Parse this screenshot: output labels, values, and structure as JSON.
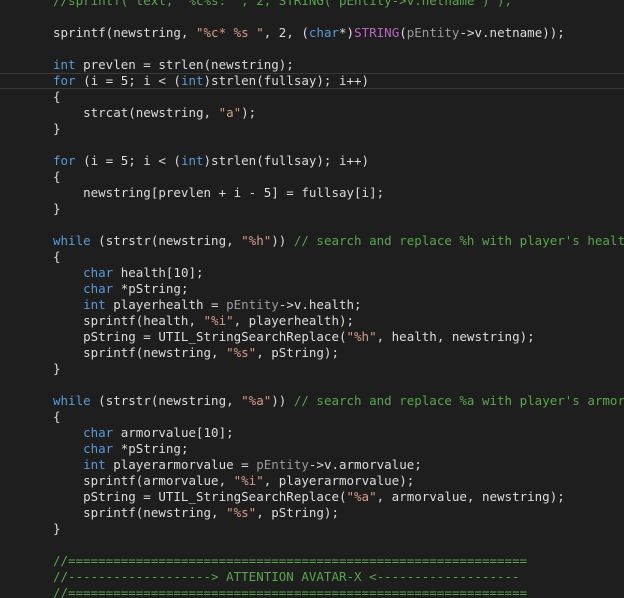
{
  "editor": {
    "colors": {
      "background": "#1e1e1e",
      "plain": "#dcdcdc",
      "keyword": "#569cd6",
      "string": "#d69d85",
      "comment": "#57a64a",
      "macro": "#bd63c5",
      "grey_member": "#9b9b9b"
    },
    "current_line_index": 5,
    "lines": [
      [
        {
          "t": "//sprintf( text, \"%c%s: \", 2, STRING( pEntity->v.netname ) );",
          "c": "c"
        }
      ],
      [],
      [
        {
          "t": "sprintf(newstring, ",
          "c": "p"
        },
        {
          "t": "\"%c* %s \"",
          "c": "s"
        },
        {
          "t": ", 2, (",
          "c": "p"
        },
        {
          "t": "char",
          "c": "k"
        },
        {
          "t": "*)",
          "c": "p"
        },
        {
          "t": "STRING",
          "c": "m"
        },
        {
          "t": "(",
          "c": "p"
        },
        {
          "t": "pEntity",
          "c": "g"
        },
        {
          "t": "->v.netname));",
          "c": "p"
        }
      ],
      [],
      [
        {
          "t": "int",
          "c": "k"
        },
        {
          "t": " prevlen = strlen(newstring);",
          "c": "p"
        }
      ],
      [
        {
          "t": "for",
          "c": "k"
        },
        {
          "t": " (i = 5; i < (",
          "c": "p"
        },
        {
          "t": "int",
          "c": "k"
        },
        {
          "t": ")strlen(fullsay); i++)",
          "c": "p"
        }
      ],
      [
        {
          "t": "{",
          "c": "p"
        }
      ],
      [
        {
          "t": "    strcat(newstring, ",
          "c": "p"
        },
        {
          "t": "\"a\"",
          "c": "s"
        },
        {
          "t": ");",
          "c": "p"
        }
      ],
      [
        {
          "t": "}",
          "c": "p"
        }
      ],
      [],
      [
        {
          "t": "for",
          "c": "k"
        },
        {
          "t": " (i = 5; i < (",
          "c": "p"
        },
        {
          "t": "int",
          "c": "k"
        },
        {
          "t": ")strlen(fullsay); i++)",
          "c": "p"
        }
      ],
      [
        {
          "t": "{",
          "c": "p"
        }
      ],
      [
        {
          "t": "    newstring[prevlen + i - 5] = fullsay[i];",
          "c": "p"
        }
      ],
      [
        {
          "t": "}",
          "c": "p"
        }
      ],
      [],
      [
        {
          "t": "while",
          "c": "k"
        },
        {
          "t": " (strstr(newstring, ",
          "c": "p"
        },
        {
          "t": "\"%h\"",
          "c": "s"
        },
        {
          "t": ")) ",
          "c": "p"
        },
        {
          "t": "// search and replace %h with player's health",
          "c": "c"
        }
      ],
      [
        {
          "t": "{",
          "c": "p"
        }
      ],
      [
        {
          "t": "    ",
          "c": "p"
        },
        {
          "t": "char",
          "c": "k"
        },
        {
          "t": " health[10];",
          "c": "p"
        }
      ],
      [
        {
          "t": "    ",
          "c": "p"
        },
        {
          "t": "char",
          "c": "k"
        },
        {
          "t": " *pString;",
          "c": "p"
        }
      ],
      [
        {
          "t": "    ",
          "c": "p"
        },
        {
          "t": "int",
          "c": "k"
        },
        {
          "t": " playerhealth = ",
          "c": "p"
        },
        {
          "t": "pEntity",
          "c": "g"
        },
        {
          "t": "->v.health;",
          "c": "p"
        }
      ],
      [
        {
          "t": "    sprintf(health, ",
          "c": "p"
        },
        {
          "t": "\"%i\"",
          "c": "s"
        },
        {
          "t": ", playerhealth);",
          "c": "p"
        }
      ],
      [
        {
          "t": "    pString = UTIL_StringSearchReplace(",
          "c": "p"
        },
        {
          "t": "\"%h\"",
          "c": "s"
        },
        {
          "t": ", health, newstring);",
          "c": "p"
        }
      ],
      [
        {
          "t": "    sprintf(newstring, ",
          "c": "p"
        },
        {
          "t": "\"%s\"",
          "c": "s"
        },
        {
          "t": ", pString);",
          "c": "p"
        }
      ],
      [
        {
          "t": "}",
          "c": "p"
        }
      ],
      [],
      [
        {
          "t": "while",
          "c": "k"
        },
        {
          "t": " (strstr(newstring, ",
          "c": "p"
        },
        {
          "t": "\"%a\"",
          "c": "s"
        },
        {
          "t": ")) ",
          "c": "p"
        },
        {
          "t": "// search and replace %a with player's armor",
          "c": "c"
        }
      ],
      [
        {
          "t": "{",
          "c": "p"
        }
      ],
      [
        {
          "t": "    ",
          "c": "p"
        },
        {
          "t": "char",
          "c": "k"
        },
        {
          "t": " armorvalue[10];",
          "c": "p"
        }
      ],
      [
        {
          "t": "    ",
          "c": "p"
        },
        {
          "t": "char",
          "c": "k"
        },
        {
          "t": " *pString;",
          "c": "p"
        }
      ],
      [
        {
          "t": "    ",
          "c": "p"
        },
        {
          "t": "int",
          "c": "k"
        },
        {
          "t": " playerarmorvalue = ",
          "c": "p"
        },
        {
          "t": "pEntity",
          "c": "g"
        },
        {
          "t": "->v.armorvalue;",
          "c": "p"
        }
      ],
      [
        {
          "t": "    sprintf(armorvalue, ",
          "c": "p"
        },
        {
          "t": "\"%i\"",
          "c": "s"
        },
        {
          "t": ", playerarmorvalue);",
          "c": "p"
        }
      ],
      [
        {
          "t": "    pString = UTIL_StringSearchReplace(",
          "c": "p"
        },
        {
          "t": "\"%a\"",
          "c": "s"
        },
        {
          "t": ", armorvalue, newstring);",
          "c": "p"
        }
      ],
      [
        {
          "t": "    sprintf(newstring, ",
          "c": "p"
        },
        {
          "t": "\"%s\"",
          "c": "s"
        },
        {
          "t": ", pString);",
          "c": "p"
        }
      ],
      [
        {
          "t": "}",
          "c": "p"
        }
      ],
      [],
      [
        {
          "t": "//=============================================================",
          "c": "c"
        }
      ],
      [
        {
          "t": "//-------------------> ATTENTION AVATAR-X <-------------------",
          "c": "c"
        }
      ],
      [
        {
          "t": "//=============================================================",
          "c": "c"
        }
      ]
    ]
  }
}
